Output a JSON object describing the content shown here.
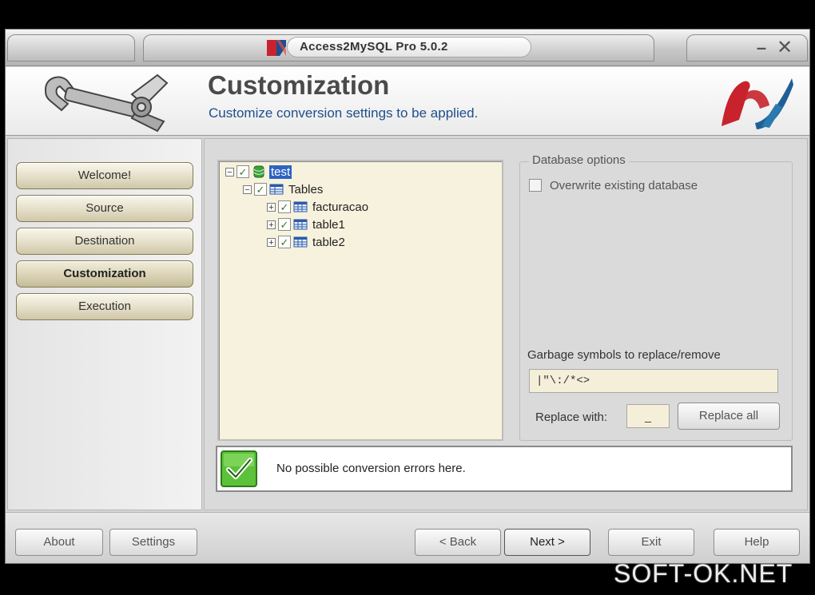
{
  "window": {
    "title": "Access2MySQL Pro 5.0.2",
    "minimize_glyph": "–",
    "close_glyph": "✕"
  },
  "header": {
    "title": "Customization",
    "subtitle": "Customize conversion settings to be applied."
  },
  "sidebar": {
    "items": [
      {
        "label": "Welcome!"
      },
      {
        "label": "Source"
      },
      {
        "label": "Destination"
      },
      {
        "label": "Customization",
        "active": true
      },
      {
        "label": "Execution"
      }
    ]
  },
  "tree": {
    "root": {
      "label": "test",
      "expander": "−",
      "checked": "✓"
    },
    "tables": {
      "label": "Tables",
      "expander": "−",
      "checked": "✓"
    },
    "items": [
      {
        "label": "facturacao",
        "expander": "+",
        "checked": "✓"
      },
      {
        "label": "table1",
        "expander": "+",
        "checked": "✓"
      },
      {
        "label": "table2",
        "expander": "+",
        "checked": "✓"
      }
    ]
  },
  "options": {
    "group_title": "Database options",
    "overwrite_label": "Overwrite existing database",
    "garbage_label": "Garbage symbols to replace/remove",
    "garbage_value": "|\"\\:/*<>",
    "replace_label": "Replace with:",
    "replace_value": "_",
    "replace_all_label": "Replace all"
  },
  "status": {
    "message": "No possible conversion errors here."
  },
  "footer": {
    "about": "About",
    "settings": "Settings",
    "back": "< Back",
    "next": "Next >",
    "exit": "Exit",
    "help": "Help"
  },
  "watermark": "SOFT-OK.NET",
  "colors": {
    "nav_button": "#e2dcc5",
    "tree_background": "#f7f2dd",
    "selection": "#2e63c4",
    "subtitle": "#1e4f8a",
    "status_check": "#4caf2a"
  }
}
